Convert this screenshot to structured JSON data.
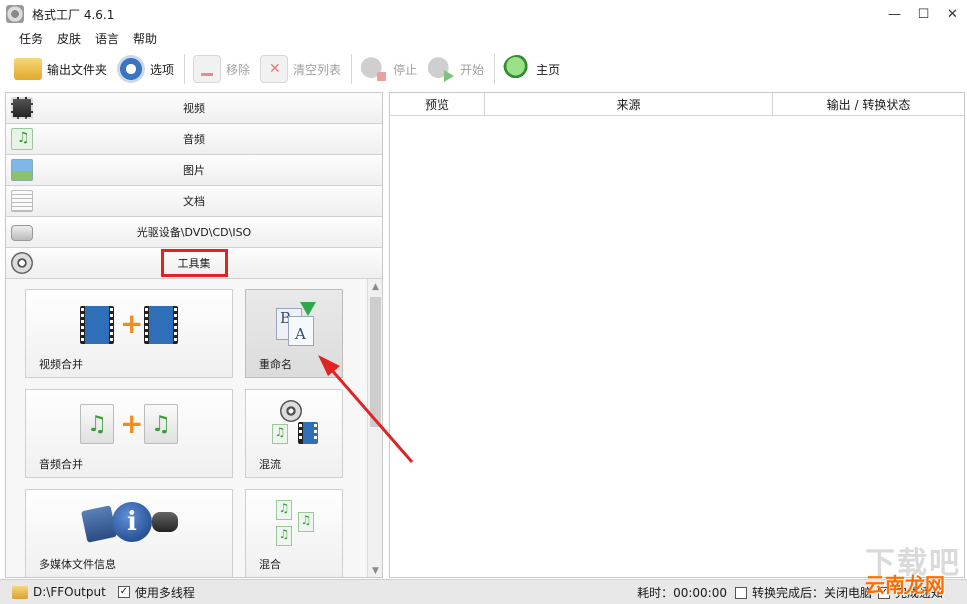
{
  "window": {
    "title": "格式工厂 4.6.1",
    "controls": [
      "—",
      "☐",
      "✕"
    ]
  },
  "menu": [
    "任务",
    "皮肤",
    "语言",
    "帮助"
  ],
  "toolbar": {
    "output_folder": "输出文件夹",
    "options": "选项",
    "remove": "移除",
    "clear_list": "清空列表",
    "stop": "停止",
    "start": "开始",
    "home": "主页"
  },
  "categories": [
    {
      "label": "视频",
      "icon": "video-clapper-icon"
    },
    {
      "label": "音频",
      "icon": "audio-note-icon"
    },
    {
      "label": "图片",
      "icon": "picture-icon"
    },
    {
      "label": "文档",
      "icon": "document-icon"
    },
    {
      "label": "光驱设备\\DVD\\CD\\ISO",
      "icon": "disc-drive-icon"
    },
    {
      "label": "工具集",
      "icon": "tools-reel-icon"
    }
  ],
  "tools": [
    {
      "label": "视频合并"
    },
    {
      "label": "重命名"
    },
    {
      "label": "音频合并"
    },
    {
      "label": "混流"
    },
    {
      "label": "多媒体文件信息"
    },
    {
      "label": "混合"
    }
  ],
  "table": {
    "columns": [
      "预览",
      "来源",
      "输出 / 转换状态"
    ]
  },
  "status": {
    "output_path": "D:\\FFOutput",
    "multithread": "使用多线程",
    "elapsed": "耗时：00:00:00",
    "after_complete": "转换完成后：关闭电脑",
    "notify": "完成通知"
  },
  "watermark": {
    "text": "云南龙网",
    "bg": "下载吧"
  },
  "colors": {
    "highlight_red": "#e02424",
    "accent_orange": "#f28b1a"
  }
}
